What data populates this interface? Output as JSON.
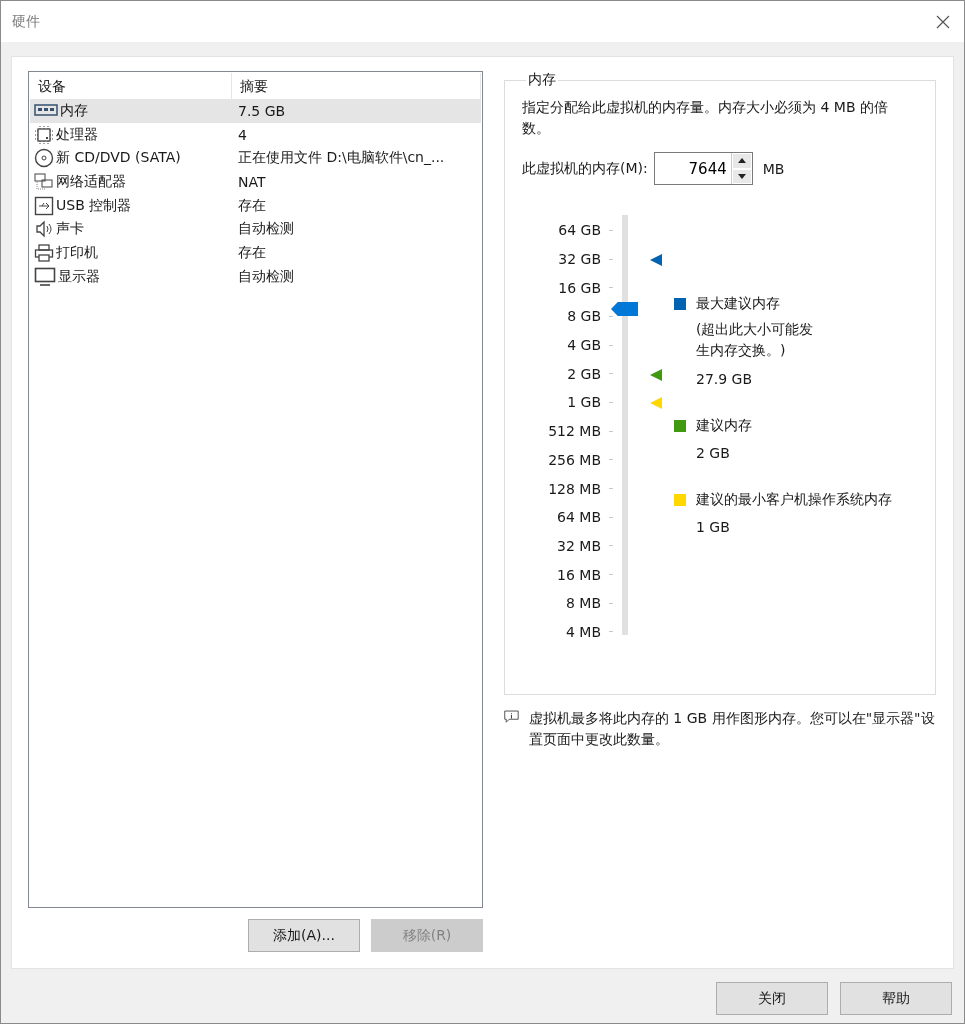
{
  "window": {
    "title": "硬件"
  },
  "device_table": {
    "columns": [
      "设备",
      "摘要"
    ],
    "rows": [
      {
        "device": "内存",
        "summary": "7.5 GB",
        "selected": true
      },
      {
        "device": "处理器",
        "summary": "4",
        "selected": false
      },
      {
        "device": "新 CD/DVD (SATA)",
        "summary": "正在使用文件 D:\\电脑软件\\cn_...",
        "selected": false
      },
      {
        "device": "网络适配器",
        "summary": "NAT",
        "selected": false
      },
      {
        "device": "USB 控制器",
        "summary": "存在",
        "selected": false
      },
      {
        "device": "声卡",
        "summary": "自动检测",
        "selected": false
      },
      {
        "device": "打印机",
        "summary": "存在",
        "selected": false
      },
      {
        "device": "显示器",
        "summary": "自动检测",
        "selected": false
      }
    ]
  },
  "list_buttons": [
    {
      "label": "添加(A)...",
      "disabled": false
    },
    {
      "label": "移除(R)",
      "disabled": true
    }
  ],
  "memory_group": {
    "title": "内存",
    "description": "指定分配给此虚拟机的内存量。内存大小必须为 4 MB 的倍数。",
    "field_label": "此虚拟机的内存(M):",
    "value": "7644",
    "unit": "MB",
    "slider": {
      "ticks": [
        "64 GB",
        "32 GB",
        "16 GB",
        "8 GB",
        "4 GB",
        "2 GB",
        "1 GB",
        "512 MB",
        "256 MB",
        "128 MB",
        "64 MB",
        "32 MB",
        "16 MB",
        "8 MB",
        "4 MB"
      ],
      "level": 0.786
    },
    "legend": [
      {
        "label": "最大建议内存",
        "note": "(超出此大小可能发生内存交换。)",
        "value": "27.9 GB",
        "color": "#0063b1"
      },
      {
        "label": "建议内存",
        "value": "2 GB",
        "color": "#3f9a0f"
      },
      {
        "label": "建议的最小客户机操作系统内存",
        "value": "1 GB",
        "color": "#ffd800"
      }
    ]
  },
  "info_note": "虚拟机最多将此内存的 1 GB 用作图形内存。您可以在\"显示器\"设置页面中更改此数量。",
  "dialog_buttons": [
    "关闭",
    "帮助"
  ]
}
